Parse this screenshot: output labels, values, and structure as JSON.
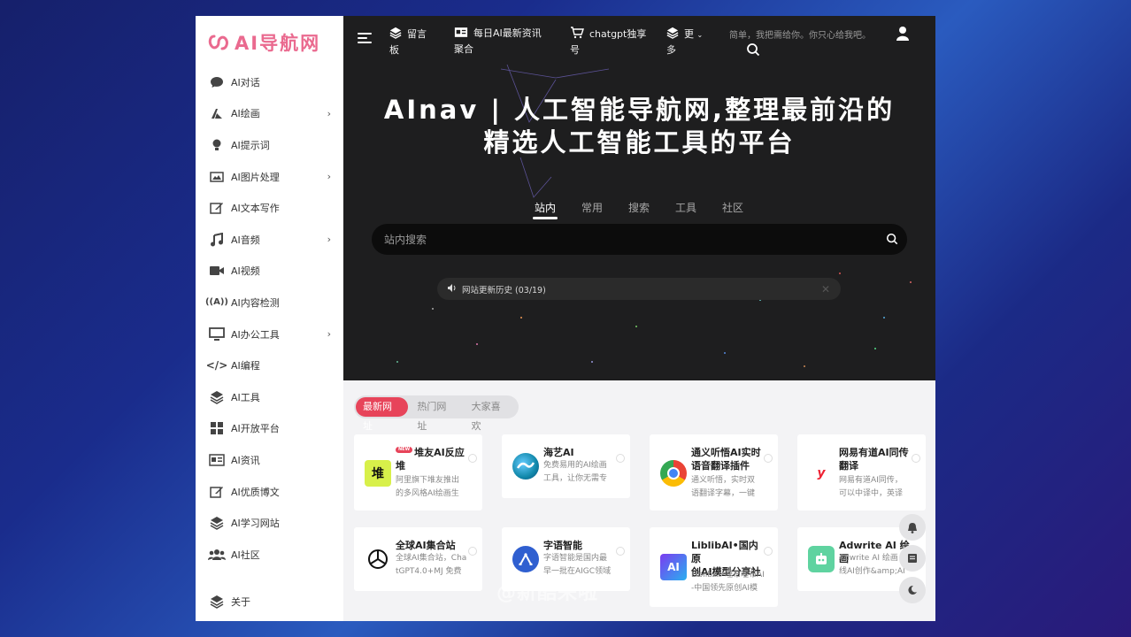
{
  "logo": {
    "text": "AI导航网",
    "accent": "#ea6a8f"
  },
  "sidebar": {
    "items": [
      {
        "label": "AI对话",
        "icon": "chat-bubble-icon",
        "has_arrow": false
      },
      {
        "label": "AI绘画",
        "icon": "paint-icon",
        "has_arrow": true
      },
      {
        "label": "AI提示词",
        "icon": "lightbulb-icon",
        "has_arrow": false
      },
      {
        "label": "AI图片处理",
        "icon": "image-icon",
        "has_arrow": true
      },
      {
        "label": "AI文本写作",
        "icon": "edit-icon",
        "has_arrow": false
      },
      {
        "label": "AI音频",
        "icon": "music-icon",
        "has_arrow": true
      },
      {
        "label": "AI视频",
        "icon": "video-icon",
        "has_arrow": false
      },
      {
        "label": "AI内容检测",
        "icon": "antenna-icon",
        "has_arrow": false
      },
      {
        "label": "AI办公工具",
        "icon": "monitor-icon",
        "has_arrow": true
      },
      {
        "label": "AI编程",
        "icon": "code-icon",
        "has_arrow": false
      },
      {
        "label": "AI工具",
        "icon": "layers-icon",
        "has_arrow": false
      },
      {
        "label": "AI开放平台",
        "icon": "grid-icon",
        "has_arrow": false
      },
      {
        "label": "AI资讯",
        "icon": "newspaper-icon",
        "has_arrow": false
      },
      {
        "label": "AI优质博文",
        "icon": "edit-icon",
        "has_arrow": false
      },
      {
        "label": "AI学习网站",
        "icon": "layers-icon",
        "has_arrow": false
      },
      {
        "label": "AI社区",
        "icon": "users-icon",
        "has_arrow": false
      }
    ],
    "bottom": {
      "label": "关于",
      "icon": "layers-icon"
    }
  },
  "topbar": {
    "items": [
      {
        "line1": "留言",
        "line2": "板",
        "icon": "layers-icon"
      },
      {
        "line1": "每日AI最新资讯",
        "line2": "聚合",
        "icon": "newspaper-icon"
      },
      {
        "line1": "chatgpt独享",
        "line2": "号",
        "icon": "cart-icon"
      },
      {
        "line1": "更",
        "line2": "多",
        "icon": "layers-icon"
      }
    ],
    "notice": "简单，我把需给你。你只心给我吧。"
  },
  "hero": {
    "title_line1": "AInav | 人工智能导航网,整理最前沿的",
    "title_line2": "精选人工智能工具的平台",
    "tabs": [
      "站内",
      "常用",
      "搜索",
      "工具",
      "社区"
    ],
    "active_tab": "站内",
    "search_placeholder": "站内搜索",
    "notice": "网站更新历史 (03/19)"
  },
  "content": {
    "filters": [
      "最新网址",
      "热门网址",
      "大家喜欢"
    ],
    "active_filter": "最新网址",
    "cards": [
      {
        "title_line1": "堆友AI反应",
        "title_line2": "堆",
        "badge": "NEW",
        "desc_line1": "阿里旗下堆友推出",
        "desc_line2": "的多风格AI绘画生",
        "icon": "duiyou-logo-icon",
        "icon_text": "堆"
      },
      {
        "title_line1": "海艺AI",
        "title_line2": "",
        "desc_line1": "免费易用的AI绘画",
        "desc_line2": "工具，让你无需专",
        "icon": "haiyi-logo-icon"
      },
      {
        "title_line1": "通义听悟AI实时",
        "title_line2": "语音翻译插件",
        "desc_line1": "通义听悟，实时双",
        "desc_line2": "语翻译字幕，一键",
        "icon": "chrome-logo-icon"
      },
      {
        "title_line1": "网易有道AI同传",
        "title_line2": "翻译",
        "desc_line1": "网易有道AI同传，",
        "desc_line2": "可以中译中，英译",
        "icon": "youdao-logo-icon",
        "icon_text": "y"
      },
      {
        "title_line1": "全球AI集合站",
        "title_line2": "",
        "desc_line1": "全球AI集合站，Cha",
        "desc_line2": "tGPT4.0+MJ 免费",
        "icon": "openai-logo-icon"
      },
      {
        "title_line1": "字语智能",
        "title_line2": "",
        "desc_line1": "字语智能是国内最",
        "desc_line2": "早一批在AIGC领域",
        "icon": "ziyu-logo-icon"
      },
      {
        "title_line1": "LiblibAI•国内原",
        "title_line2": "创AI模型分享社",
        "desc_line1": "LiblibAI•哩布哩布AI",
        "desc_line2": "-中国领先原创AI模",
        "icon": "liblib-logo-icon",
        "icon_text": "AI"
      },
      {
        "title_line1": "Adwrite AI 绘画",
        "title_line2": "",
        "desc_line1": "Adwrite AI 绘画 |",
        "desc_line2": "线AI创作&amp;AI",
        "icon": "adwrite-logo-icon"
      }
    ]
  },
  "watermark": "@新酷来啦"
}
